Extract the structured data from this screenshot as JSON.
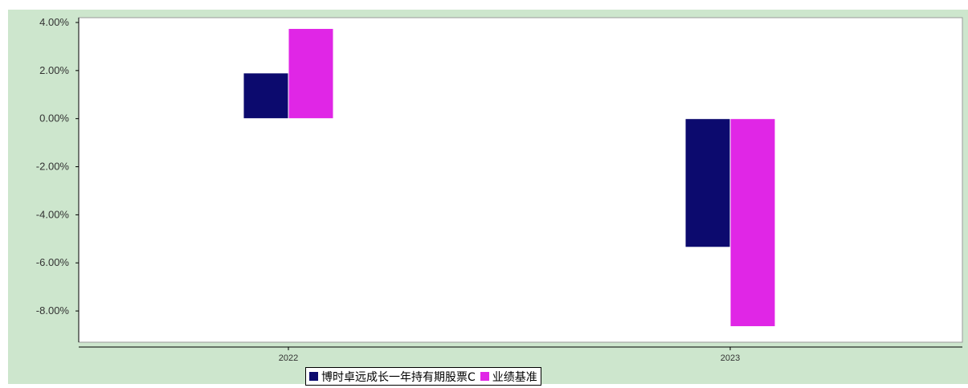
{
  "chart_data": {
    "type": "bar",
    "categories": [
      "2022",
      "2023"
    ],
    "series": [
      {
        "name": "博时卓远成长一年持有期股票C",
        "values": [
          1.9,
          -5.35
        ],
        "color": "#0c0a6e"
      },
      {
        "name": "业绩基准",
        "values": [
          3.75,
          -8.65
        ],
        "color": "#e026e6"
      }
    ],
    "title": "",
    "xlabel": "",
    "ylabel": "",
    "ylim": [
      -9.3,
      4.2
    ],
    "yticks": [
      4,
      2,
      0,
      -2,
      -4,
      -6,
      -8
    ],
    "ytick_labels": [
      "4.00%",
      "2.00%",
      "0.00%",
      "-2.00%",
      "-4.00%",
      "-6.00%",
      "-8.00%"
    ],
    "grid": false,
    "legend_position": "bottom",
    "colors": {
      "frame_background": "#cde6cd",
      "plot_background": "#ffffff",
      "axis": "#7a7a7a"
    }
  }
}
